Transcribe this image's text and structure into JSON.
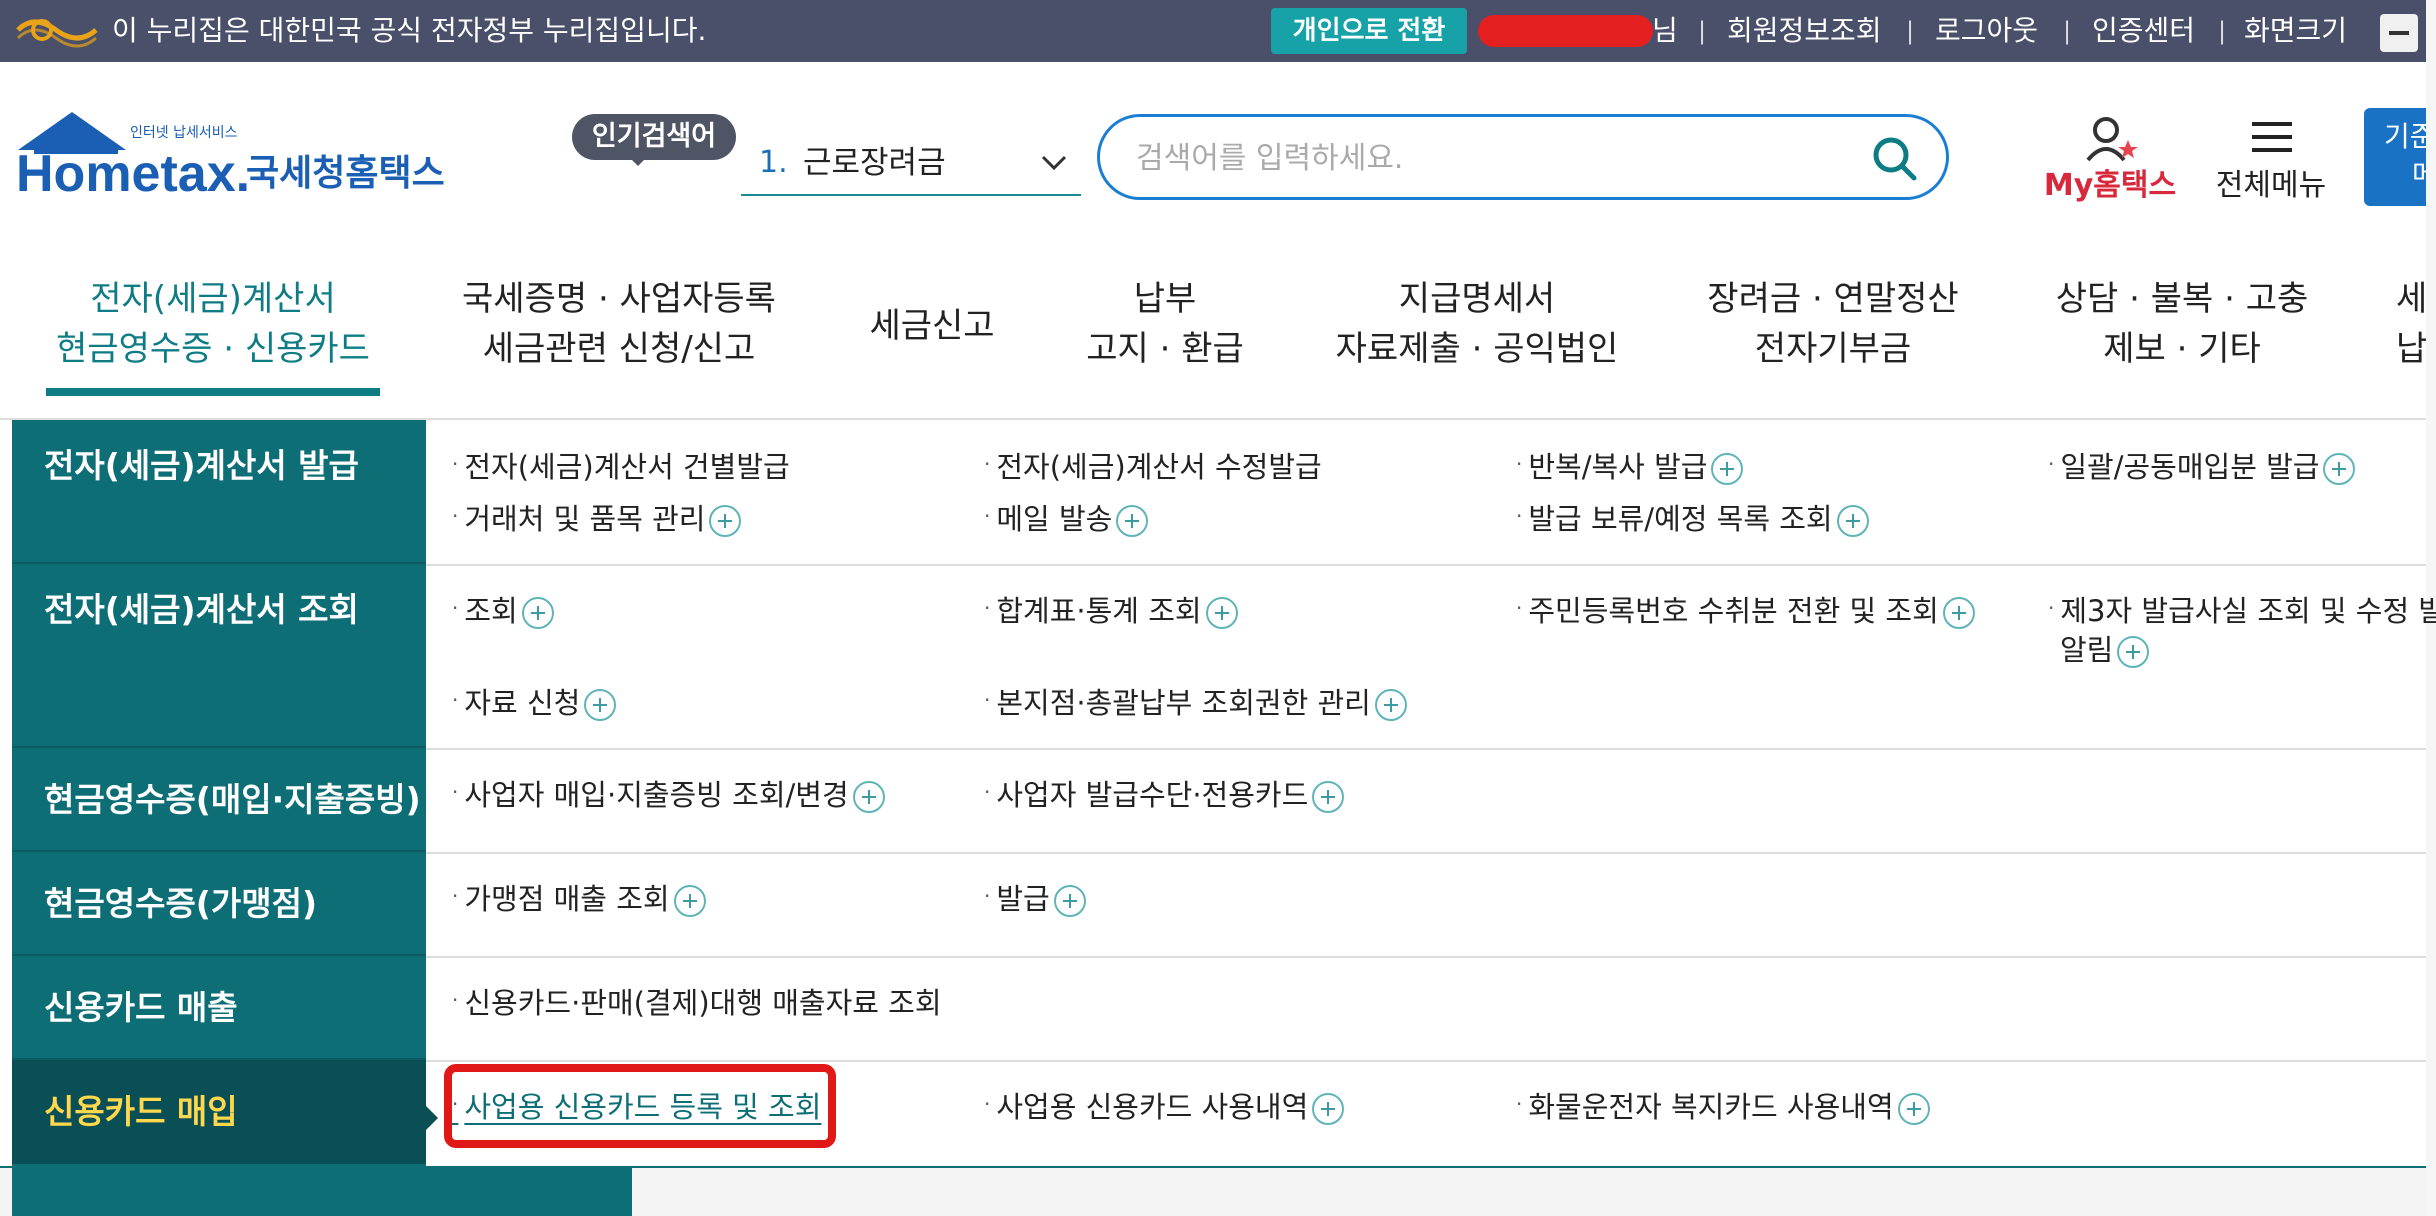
{
  "topbar": {
    "notice": "이 누리집은 대한민국 공식 전자정부 누리집입니다.",
    "switch_label": "개인으로 전환",
    "user_suffix": "님",
    "links": [
      "회원정보조회",
      "로그아웃",
      "인증센터",
      "화면크기"
    ],
    "separator": "|",
    "bg_color": "#4a4f6a",
    "switch_color": "#17a2a8"
  },
  "header": {
    "logo_top_text": "인터넷 납세서비스",
    "logo_brand": "Hometax.",
    "logo_korean": "국세청홈택스",
    "popular_badge": "인기검색어",
    "popular_rank": "1.",
    "popular_term": "근로장려금",
    "search_placeholder": "검색어를 입력하세요.",
    "my_hometax_label": "My홈택스",
    "all_menu_label": "전체메뉴",
    "blue_button_text": "기준\n메",
    "icons": {
      "search": "search-icon",
      "my": "person-star-icon",
      "menu": "hamburger-icon",
      "chevron": "chevron-down-icon"
    }
  },
  "nav": [
    {
      "line1": "전자(세금)계산서",
      "line2": "현금영수증 · 신용카드",
      "active": true
    },
    {
      "line1": "국세증명 · 사업자등록",
      "line2": "세금관련 신청/신고"
    },
    {
      "line1": "세금신고",
      "line2": ""
    },
    {
      "line1": "납부",
      "line2": "고지 · 환급"
    },
    {
      "line1": "지급명세서",
      "line2": "자료제출 · 공익법인"
    },
    {
      "line1": "장려금 · 연말정산",
      "line2": "전자기부금"
    },
    {
      "line1": "상담 · 불복 · 고충",
      "line2": "제보 · 기타"
    },
    {
      "line1": "세",
      "line2": "납"
    }
  ],
  "sidebar": [
    "전자(세금)계산서 발급",
    "전자(세금)계산서 조회",
    "현금영수증(매입·지출증빙)",
    "현금영수증(가맹점)",
    "신용카드 매출",
    "신용카드 매입"
  ],
  "menu_links": {
    "r1": [
      "전자(세금)계산서 건별발급",
      "전자(세금)계산서 수정발급",
      "반복/복사 발급",
      "일괄/공동매입분 발급",
      "거래처 및 품목 관리",
      "메일 발송",
      "발급 보류/예정 목록 조회"
    ],
    "r2": [
      "조회",
      "합계표·통계 조회",
      "주민등록번호 수취분 전환 및 조회",
      "제3자 발급사실 조회 및 수정 발",
      "알림",
      "자료 신청",
      "본지점·총괄납부 조회권한 관리"
    ],
    "r3": [
      "사업자 매입·지출증빙 조회/변경",
      "사업자 발급수단·전용카드"
    ],
    "r4": [
      "가맹점 매출 조회",
      "발급"
    ],
    "r5": [
      "신용카드·판매(결제)대행 매출자료 조회"
    ],
    "r6": [
      "사업용 신용카드 등록 및 조회",
      "사업용 신용카드 사용내역",
      "화물운전자 복지카드 사용내역"
    ],
    "bullet": "·"
  },
  "colors": {
    "teal_dark": "#0e6e76",
    "active_yellow": "#ffd84d",
    "highlight_red": "#e01818",
    "search_blue": "#1a7fd4",
    "my_red": "#d8283c"
  }
}
